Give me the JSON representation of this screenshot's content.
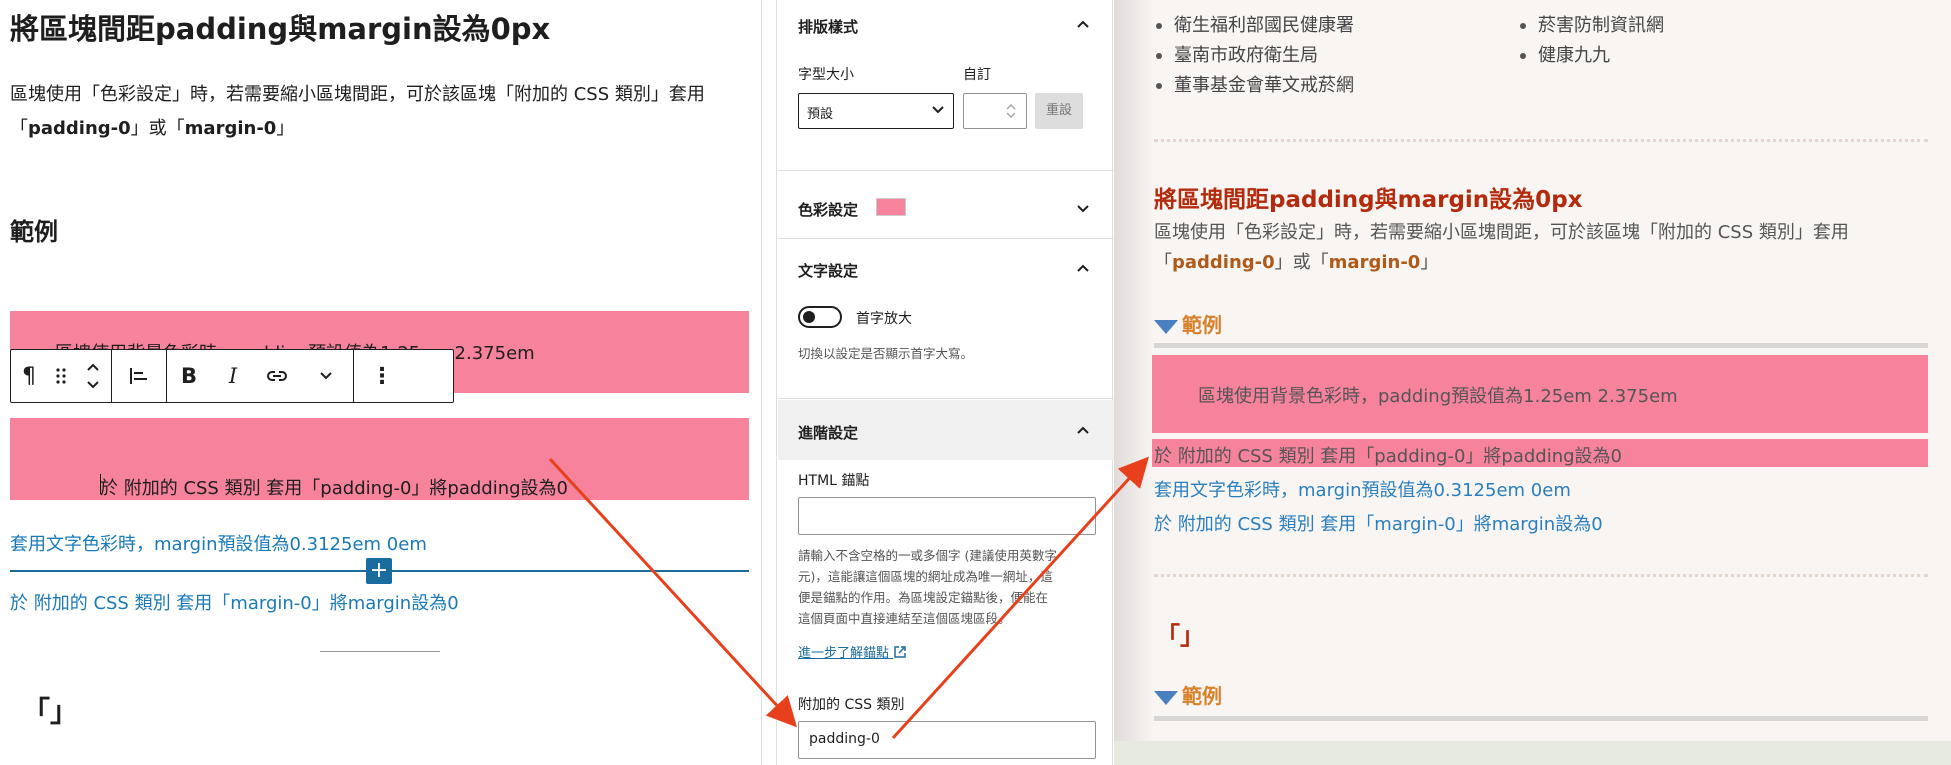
{
  "editor": {
    "title": "將區塊間距padding與margin設為0px",
    "para_pre": "區塊使用「色彩設定」時，若需要縮小區塊間距，可於該區塊「附加的 CSS 類別」套用「",
    "para_code1": "padding-0",
    "para_mid": "」或「",
    "para_code2": "margin-0",
    "para_post": "」",
    "example_heading": "範例",
    "block1_text": "區塊使用背景色彩時，padding預設值為1.25em 2.375em",
    "block2_text": "於 附加的 CSS 類別 套用「padding-0」將padding設為0",
    "link1": "套用文字色彩時，margin預設值為0.3125em 0em",
    "link2": "於 附加的 CSS 類別 套用「margin-0」將margin設為0",
    "quote": "「」",
    "insert_symbol": "+"
  },
  "toolbar": {
    "paragraph_glyph": "¶",
    "bold": "B",
    "italic": "I",
    "more": "⋮"
  },
  "sidebar": {
    "typography_title": "排版樣式",
    "font_size_label": "字型大小",
    "custom_label": "自訂",
    "font_size_value": "預設",
    "reset_label": "重設",
    "color_title": "色彩設定",
    "color_swatch": "#f7829c",
    "text_title": "文字設定",
    "dropcap_label": "首字放大",
    "dropcap_hint": "切換以設定是否顯示首字大寫。",
    "advanced_title": "進階設定",
    "anchor_label": "HTML 錨點",
    "anchor_hint_1": "請輸入不含空格的一或多個字 (建議使用英數字",
    "anchor_hint_2": "元)，這能讓這個區塊的網址成為唯一網址，這",
    "anchor_hint_3": "便是錨點的作用。為區塊設定錨點後，便能在",
    "anchor_hint_4": "這個頁面中直接連結至這個區塊區段。",
    "learn_more": "進一步了解錨點",
    "css_class_label": "附加的 CSS 類別",
    "css_class_value": "padding-0"
  },
  "preview": {
    "list_left": [
      "衛生福利部國民健康署",
      "臺南市政府衛生局",
      "董事基金會華文戒菸網"
    ],
    "list_right": [
      "菸害防制資訊網",
      "健康九九"
    ],
    "title": "將區塊間距padding與margin設為0px",
    "para_pre": "區塊使用「色彩設定」時，若需要縮小區塊間距，可於該區塊「附加的 CSS 類別」套用「",
    "para_code1": "padding-0",
    "para_mid": "」或「",
    "para_code2": "margin-0",
    "para_post": "」",
    "example_heading": "範例",
    "block1_text": "區塊使用背景色彩時，padding預設值為1.25em 2.375em",
    "block2_text": "於 附加的 CSS 類別 套用「padding-0」將padding設為0",
    "link1": "套用文字色彩時，margin預設值為0.3125em 0em",
    "link2": "於 附加的 CSS 類別 套用「margin-0」將margin設為0",
    "quote": "「」",
    "example_heading_2": "範例"
  },
  "colors": {
    "accent_pink": "#f7829c",
    "link_blue": "#1a7ab8",
    "heading_red": "#b32a0c",
    "subheading_orange": "#d9822b",
    "arrow_red": "#e8401c"
  }
}
